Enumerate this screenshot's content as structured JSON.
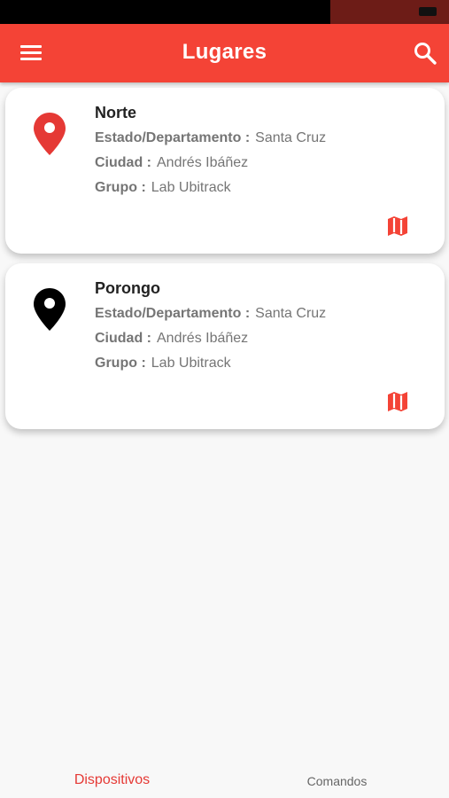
{
  "app_bar": {
    "title": "Lugares",
    "color": "#f44336",
    "menu_icon": "menu-icon",
    "search_icon": "search-icon"
  },
  "places": [
    {
      "name": "Norte",
      "pin_color": "#e53935",
      "estado_label": "Estado/Departamento :",
      "estado_value": "Santa Cruz",
      "ciudad_label": "Ciudad :",
      "ciudad_value": "Andrés Ibáñez",
      "grupo_label": "Grupo :",
      "grupo_value": "Lab Ubitrack",
      "map_icon": "map-icon"
    },
    {
      "name": "Porongo",
      "pin_color": "#000000",
      "estado_label": "Estado/Departamento :",
      "estado_value": "Santa Cruz",
      "ciudad_label": "Ciudad :",
      "ciudad_value": "Andrés Ibáñez",
      "grupo_label": "Grupo :",
      "grupo_value": "Lab Ubitrack",
      "map_icon": "map-icon"
    }
  ],
  "bottom_nav": {
    "items": [
      {
        "label": "Dispositivos",
        "active": true
      },
      {
        "label": "Comandos",
        "active": false
      }
    ],
    "active_color": "#e53935"
  }
}
